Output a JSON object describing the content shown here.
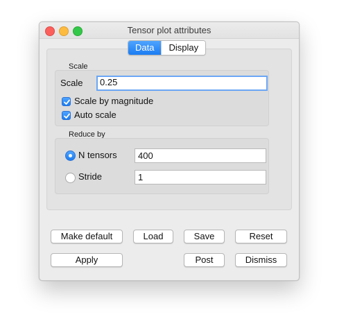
{
  "window": {
    "title": "Tensor plot attributes"
  },
  "tabs": [
    {
      "label": "Data",
      "active": true
    },
    {
      "label": "Display",
      "active": false
    }
  ],
  "scale_group": {
    "title": "Scale",
    "scale_label": "Scale",
    "scale_value": "0.25",
    "scale_by_magnitude": {
      "label": "Scale by magnitude",
      "checked": true
    },
    "auto_scale": {
      "label": "Auto scale",
      "checked": true
    }
  },
  "reduce_group": {
    "title": "Reduce by",
    "n_tensors": {
      "label": "N tensors",
      "selected": true,
      "value": "400"
    },
    "stride": {
      "label": "Stride",
      "selected": false,
      "value": "1"
    }
  },
  "buttons": {
    "make_default": "Make default",
    "load": "Load",
    "save": "Save",
    "reset": "Reset",
    "apply": "Apply",
    "post": "Post",
    "dismiss": "Dismiss"
  },
  "colors": {
    "accent": "#1b7cf2",
    "close": "#fc605c",
    "minimize": "#fdbc40",
    "maximize": "#34c84a"
  }
}
